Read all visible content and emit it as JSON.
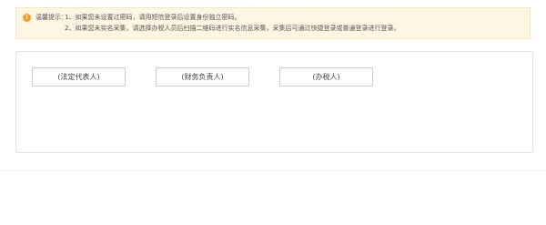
{
  "notice": {
    "icon": "warning-icon",
    "icon_glyph": "!",
    "title": "温馨提示：",
    "line1": "1、如果您未设置过密码，请用短信登录后设置身份独立密码。",
    "line2": "2、如果您未实名采集，请选择办税人员后扫描二维码进行实名信息采集，采集后可通过快捷登录或普通登录进行登录。",
    "accent_color": "#f2a030",
    "background_color": "#fef6e3"
  },
  "roles": {
    "legal_rep": "(法定代表人)",
    "finance": "(财务负责人)",
    "tax_handler": "(办税人)"
  }
}
